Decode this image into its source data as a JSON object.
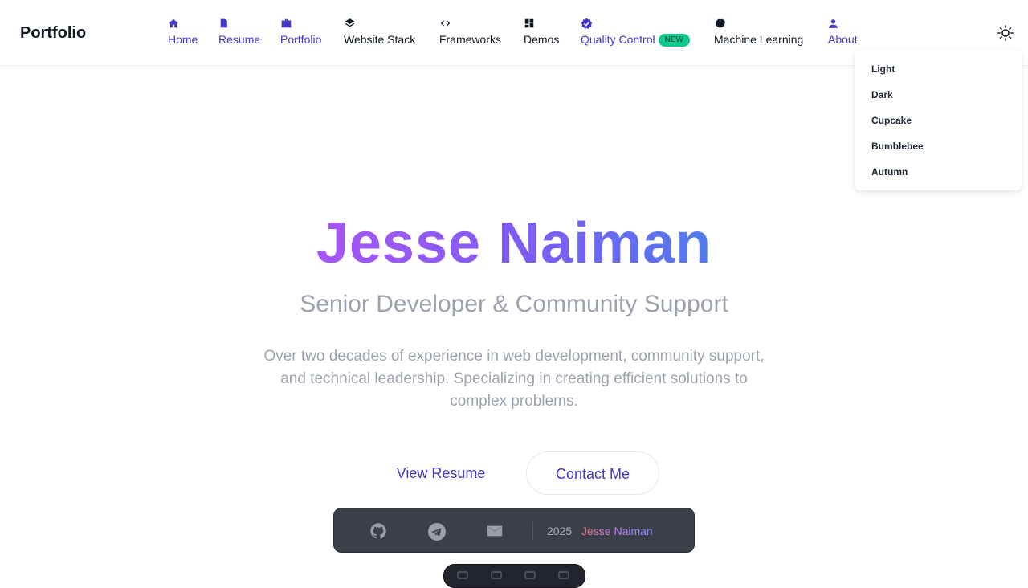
{
  "brand": "Portfolio",
  "nav": {
    "items": [
      {
        "label": "Home",
        "icon": "home-icon"
      },
      {
        "label": "Resume",
        "icon": "document-icon"
      },
      {
        "label": "Portfolio",
        "icon": "briefcase-icon"
      },
      {
        "label": "Website Stack",
        "icon": "layers-icon"
      },
      {
        "label": "Frameworks",
        "icon": "code-icon"
      },
      {
        "label": "Demos",
        "icon": "dashboard-icon"
      },
      {
        "label": "Quality Control",
        "icon": "verified-badge-icon",
        "badge": "NEW"
      },
      {
        "label": "Machine Learning",
        "icon": "brain-icon"
      },
      {
        "label": "About",
        "icon": "person-icon"
      }
    ]
  },
  "theme": {
    "icon": "sun-icon",
    "options": [
      "Light",
      "Dark",
      "Cupcake",
      "Bumblebee",
      "Autumn"
    ]
  },
  "hero": {
    "name": "Jesse Naiman",
    "subtitle": "Senior Developer & Community Support",
    "description": "Over two decades of experience in web development, community support, and technical leadership. Specializing in creating efficient solutions to complex problems.",
    "primary_cta": "View Resume",
    "secondary_cta": "Contact Me"
  },
  "footer": {
    "icons": [
      "github-icon",
      "telegram-icon",
      "email-icon"
    ],
    "year": "2025",
    "name": "Jesse Naiman"
  },
  "colors": {
    "accent": "#4338ca",
    "badge": "#10c98f",
    "gradient_start": "#a855f7",
    "gradient_end": "#4f7cf0",
    "footer_bg": "#3b3f4a"
  }
}
